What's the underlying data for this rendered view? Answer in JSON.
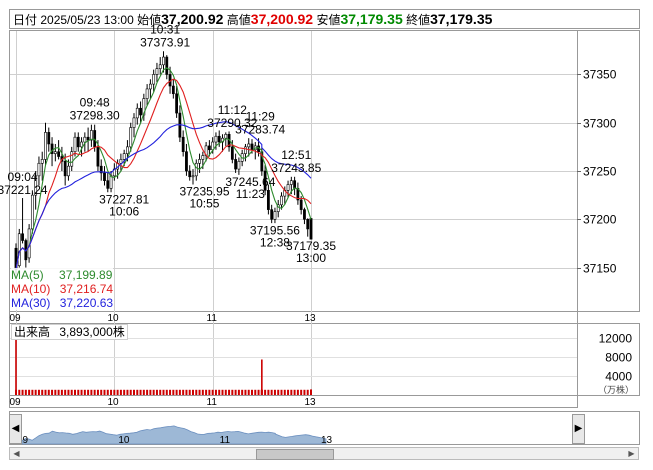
{
  "info": {
    "date_label": "日付",
    "datetime": "2025/05/23 13:00",
    "open_label": "始値",
    "open": "37,200.92",
    "high_label": "高値",
    "high": "37,200.92",
    "low_label": "安値",
    "low": "37,179.35",
    "close_label": "終値",
    "close": "37,179.35"
  },
  "legend": {
    "ma5_label": "MA(5)",
    "ma5_value": "37,199.89",
    "ma10_label": "MA(10)",
    "ma10_value": "37,216.74",
    "ma30_label": "MA(30)",
    "ma30_value": "37,220.63"
  },
  "volume": {
    "label": "出来高",
    "value": "3,893,000株",
    "unit": "（万株）"
  },
  "colors": {
    "up": "#ffffff",
    "down": "#000000",
    "ma5": "#2e8b2e",
    "ma10": "#e02020",
    "ma30": "#2222dd",
    "volume": "#cc0000",
    "navigator_fill": "#9db8d6"
  },
  "nav": {
    "left_icon": "triangle-left-icon",
    "right_icon": "triangle-right-icon"
  },
  "chart_data": {
    "type": "candlestick",
    "price_ylim": [
      37105,
      37395
    ],
    "price_ticks": [
      37150,
      37200,
      37250,
      37300,
      37350
    ],
    "volume_ylim": [
      0,
      15000
    ],
    "volume_ticks": [
      4000,
      8000,
      12000
    ],
    "time_range": [
      "09:00",
      "13:00"
    ],
    "x_ticks": [
      "09",
      "10",
      "11",
      "13"
    ],
    "navigator_ticks": [
      "09",
      "10",
      "11",
      "13"
    ],
    "candles": [
      {
        "t": "09:00",
        "o": 37170,
        "h": 37175,
        "l": 37140,
        "c": 37148
      },
      {
        "t": "09:02",
        "o": 37152,
        "h": 37190,
        "l": 37150,
        "c": 37185
      },
      {
        "t": "09:04",
        "o": 37185,
        "h": 37222,
        "l": 37175,
        "c": 37178
      },
      {
        "t": "09:06",
        "o": 37178,
        "h": 37180,
        "l": 37150,
        "c": 37158
      },
      {
        "t": "09:08",
        "o": 37160,
        "h": 37195,
        "l": 37155,
        "c": 37190
      },
      {
        "t": "09:10",
        "o": 37190,
        "h": 37230,
        "l": 37185,
        "c": 37225
      },
      {
        "t": "09:12",
        "o": 37225,
        "h": 37250,
        "l": 37210,
        "c": 37245
      },
      {
        "t": "09:14",
        "o": 37245,
        "h": 37265,
        "l": 37235,
        "c": 37258
      },
      {
        "t": "09:16",
        "o": 37258,
        "h": 37270,
        "l": 37240,
        "c": 37262
      },
      {
        "t": "09:18",
        "o": 37262,
        "h": 37300,
        "l": 37255,
        "c": 37290
      },
      {
        "t": "09:20",
        "o": 37290,
        "h": 37295,
        "l": 37270,
        "c": 37278
      },
      {
        "t": "09:22",
        "o": 37278,
        "h": 37285,
        "l": 37255,
        "c": 37268
      },
      {
        "t": "09:24",
        "o": 37268,
        "h": 37278,
        "l": 37260,
        "c": 37270
      },
      {
        "t": "09:26",
        "o": 37270,
        "h": 37282,
        "l": 37262,
        "c": 37265
      },
      {
        "t": "09:28",
        "o": 37265,
        "h": 37275,
        "l": 37250,
        "c": 37260
      },
      {
        "t": "09:30",
        "o": 37260,
        "h": 37268,
        "l": 37235,
        "c": 37245
      },
      {
        "t": "09:32",
        "o": 37245,
        "h": 37262,
        "l": 37240,
        "c": 37255
      },
      {
        "t": "09:34",
        "o": 37255,
        "h": 37275,
        "l": 37250,
        "c": 37270
      },
      {
        "t": "09:36",
        "o": 37270,
        "h": 37290,
        "l": 37265,
        "c": 37285
      },
      {
        "t": "09:38",
        "o": 37285,
        "h": 37290,
        "l": 37270,
        "c": 37275
      },
      {
        "t": "09:40",
        "o": 37275,
        "h": 37285,
        "l": 37265,
        "c": 37280
      },
      {
        "t": "09:42",
        "o": 37280,
        "h": 37290,
        "l": 37270,
        "c": 37285
      },
      {
        "t": "09:44",
        "o": 37285,
        "h": 37295,
        "l": 37270,
        "c": 37282
      },
      {
        "t": "09:46",
        "o": 37282,
        "h": 37298,
        "l": 37275,
        "c": 37292
      },
      {
        "t": "09:48",
        "o": 37292,
        "h": 37298,
        "l": 37270,
        "c": 37275
      },
      {
        "t": "09:50",
        "o": 37275,
        "h": 37282,
        "l": 37250,
        "c": 37255
      },
      {
        "t": "09:52",
        "o": 37255,
        "h": 37262,
        "l": 37240,
        "c": 37248
      },
      {
        "t": "09:54",
        "o": 37248,
        "h": 37255,
        "l": 37235,
        "c": 37240
      },
      {
        "t": "09:56",
        "o": 37240,
        "h": 37248,
        "l": 37228,
        "c": 37232
      },
      {
        "t": "09:58",
        "o": 37232,
        "h": 37250,
        "l": 37228,
        "c": 37245
      },
      {
        "t": "10:00",
        "o": 37245,
        "h": 37258,
        "l": 37240,
        "c": 37252
      },
      {
        "t": "10:02",
        "o": 37252,
        "h": 37262,
        "l": 37242,
        "c": 37258
      },
      {
        "t": "10:04",
        "o": 37258,
        "h": 37268,
        "l": 37250,
        "c": 37262
      },
      {
        "t": "10:06",
        "o": 37262,
        "h": 37272,
        "l": 37255,
        "c": 37268
      },
      {
        "t": "10:08",
        "o": 37268,
        "h": 37282,
        "l": 37260,
        "c": 37275
      },
      {
        "t": "10:10",
        "o": 37275,
        "h": 37300,
        "l": 37270,
        "c": 37295
      },
      {
        "t": "10:12",
        "o": 37295,
        "h": 37310,
        "l": 37285,
        "c": 37305
      },
      {
        "t": "10:14",
        "o": 37305,
        "h": 37320,
        "l": 37298,
        "c": 37315
      },
      {
        "t": "10:16",
        "o": 37315,
        "h": 37322,
        "l": 37300,
        "c": 37308
      },
      {
        "t": "10:18",
        "o": 37308,
        "h": 37330,
        "l": 37302,
        "c": 37325
      },
      {
        "t": "10:20",
        "o": 37325,
        "h": 37340,
        "l": 37318,
        "c": 37335
      },
      {
        "t": "10:22",
        "o": 37335,
        "h": 37345,
        "l": 37325,
        "c": 37340
      },
      {
        "t": "10:24",
        "o": 37340,
        "h": 37355,
        "l": 37332,
        "c": 37350
      },
      {
        "t": "10:26",
        "o": 37350,
        "h": 37362,
        "l": 37342,
        "c": 37356
      },
      {
        "t": "10:28",
        "o": 37356,
        "h": 37368,
        "l": 37350,
        "c": 37360
      },
      {
        "t": "10:30",
        "o": 37360,
        "h": 37374,
        "l": 37352,
        "c": 37368
      },
      {
        "t": "10:32",
        "o": 37368,
        "h": 37370,
        "l": 37345,
        "c": 37350
      },
      {
        "t": "10:34",
        "o": 37350,
        "h": 37358,
        "l": 37330,
        "c": 37338
      },
      {
        "t": "10:36",
        "o": 37338,
        "h": 37345,
        "l": 37325,
        "c": 37330
      },
      {
        "t": "10:38",
        "o": 37330,
        "h": 37338,
        "l": 37305,
        "c": 37310
      },
      {
        "t": "10:40",
        "o": 37310,
        "h": 37318,
        "l": 37280,
        "c": 37285
      },
      {
        "t": "10:42",
        "o": 37285,
        "h": 37292,
        "l": 37265,
        "c": 37270
      },
      {
        "t": "10:44",
        "o": 37270,
        "h": 37278,
        "l": 37245,
        "c": 37250
      },
      {
        "t": "10:46",
        "o": 37250,
        "h": 37256,
        "l": 37240,
        "c": 37244
      },
      {
        "t": "10:48",
        "o": 37244,
        "h": 37252,
        "l": 37236,
        "c": 37245
      },
      {
        "t": "10:50",
        "o": 37245,
        "h": 37262,
        "l": 37240,
        "c": 37258
      },
      {
        "t": "10:52",
        "o": 37258,
        "h": 37268,
        "l": 37248,
        "c": 37262
      },
      {
        "t": "10:54",
        "o": 37262,
        "h": 37270,
        "l": 37252,
        "c": 37266
      },
      {
        "t": "10:56",
        "o": 37266,
        "h": 37280,
        "l": 37260,
        "c": 37276
      },
      {
        "t": "10:58",
        "o": 37276,
        "h": 37282,
        "l": 37265,
        "c": 37272
      },
      {
        "t": "11:00",
        "o": 37272,
        "h": 37285,
        "l": 37268,
        "c": 37280
      },
      {
        "t": "11:02",
        "o": 37280,
        "h": 37290,
        "l": 37272,
        "c": 37286
      },
      {
        "t": "11:04",
        "o": 37286,
        "h": 37292,
        "l": 37275,
        "c": 37280
      },
      {
        "t": "11:06",
        "o": 37280,
        "h": 37288,
        "l": 37270,
        "c": 37284
      },
      {
        "t": "11:08",
        "o": 37284,
        "h": 37290,
        "l": 37276,
        "c": 37288
      },
      {
        "t": "11:10",
        "o": 37288,
        "h": 37291,
        "l": 37270,
        "c": 37275
      },
      {
        "t": "11:12",
        "o": 37275,
        "h": 37282,
        "l": 37258,
        "c": 37262
      },
      {
        "t": "11:14",
        "o": 37262,
        "h": 37268,
        "l": 37248,
        "c": 37252
      },
      {
        "t": "11:16",
        "o": 37252,
        "h": 37264,
        "l": 37246,
        "c": 37260
      },
      {
        "t": "11:18",
        "o": 37260,
        "h": 37272,
        "l": 37255,
        "c": 37268
      },
      {
        "t": "11:20",
        "o": 37268,
        "h": 37278,
        "l": 37260,
        "c": 37275
      },
      {
        "t": "11:22",
        "o": 37275,
        "h": 37284,
        "l": 37265,
        "c": 37278
      },
      {
        "t": "11:24",
        "o": 37278,
        "h": 37283,
        "l": 37268,
        "c": 37272
      },
      {
        "t": "11:26",
        "o": 37272,
        "h": 37280,
        "l": 37262,
        "c": 37276
      },
      {
        "t": "11:28",
        "o": 37276,
        "h": 37284,
        "l": 37265,
        "c": 37270
      },
      {
        "t": "11:30",
        "o": 37270,
        "h": 37274,
        "l": 37255,
        "c": 37260
      },
      {
        "t": "12:30",
        "o": 37262,
        "h": 37270,
        "l": 37245,
        "c": 37250
      },
      {
        "t": "12:32",
        "o": 37250,
        "h": 37256,
        "l": 37225,
        "c": 37230
      },
      {
        "t": "12:34",
        "o": 37230,
        "h": 37236,
        "l": 37205,
        "c": 37210
      },
      {
        "t": "12:36",
        "o": 37210,
        "h": 37215,
        "l": 37196,
        "c": 37200
      },
      {
        "t": "12:38",
        "o": 37200,
        "h": 37212,
        "l": 37196,
        "c": 37208
      },
      {
        "t": "12:40",
        "o": 37208,
        "h": 37220,
        "l": 37202,
        "c": 37215
      },
      {
        "t": "12:42",
        "o": 37215,
        "h": 37228,
        "l": 37210,
        "c": 37224
      },
      {
        "t": "12:44",
        "o": 37224,
        "h": 37234,
        "l": 37216,
        "c": 37230
      },
      {
        "t": "12:46",
        "o": 37230,
        "h": 37240,
        "l": 37222,
        "c": 37236
      },
      {
        "t": "12:48",
        "o": 37236,
        "h": 37244,
        "l": 37226,
        "c": 37240
      },
      {
        "t": "12:50",
        "o": 37240,
        "h": 37244,
        "l": 37225,
        "c": 37232
      },
      {
        "t": "12:52",
        "o": 37232,
        "h": 37238,
        "l": 37215,
        "c": 37220
      },
      {
        "t": "12:54",
        "o": 37220,
        "h": 37224,
        "l": 37205,
        "c": 37210
      },
      {
        "t": "12:56",
        "o": 37210,
        "h": 37212,
        "l": 37195,
        "c": 37200
      },
      {
        "t": "12:58",
        "o": 37200,
        "h": 37201,
        "l": 37182,
        "c": 37190
      },
      {
        "t": "13:00",
        "o": 37200.92,
        "h": 37200.92,
        "l": 37179.35,
        "c": 37179.35
      }
    ],
    "annotations": [
      {
        "time": "09:04",
        "value": "37221.24",
        "anchor": "high"
      },
      {
        "time": "09:48",
        "value": "37298.30",
        "anchor": "high"
      },
      {
        "time": "10:06",
        "value": "37227.81",
        "anchor": "low"
      },
      {
        "time": "10:31",
        "value": "37373.91",
        "anchor": "high"
      },
      {
        "time": "10:55",
        "value": "37235.95",
        "anchor": "low"
      },
      {
        "time": "11:12",
        "value": "37290.32",
        "anchor": "high"
      },
      {
        "time": "11:23",
        "value": "37245.64",
        "anchor": "low"
      },
      {
        "time": "11:29",
        "value": "37283.74",
        "anchor": "high"
      },
      {
        "time": "12:38",
        "value": "37195.56",
        "anchor": "low"
      },
      {
        "time": "12:51",
        "value": "37243.85",
        "anchor": "high"
      },
      {
        "time": "13:00",
        "value": "37179.35",
        "anchor": "low"
      }
    ],
    "volume_bars": [
      {
        "t": "09:00",
        "v": 14800
      },
      {
        "t": "12:30",
        "v": 7500
      },
      {
        "t": "13:00",
        "v": 1200
      }
    ],
    "volume_base": 1100
  }
}
